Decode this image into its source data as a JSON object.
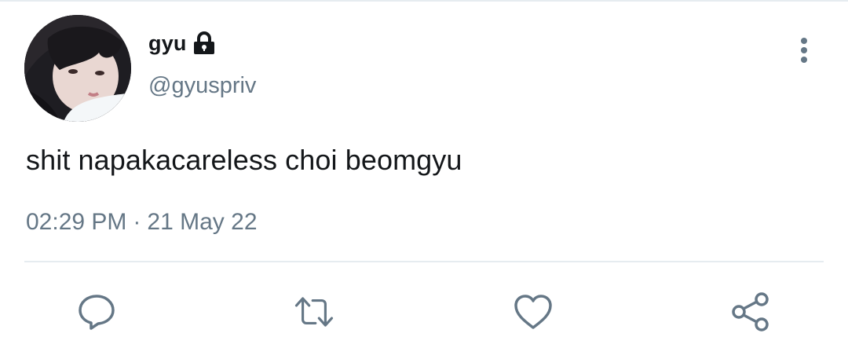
{
  "tweet": {
    "author": {
      "display_name": "gyu",
      "handle": "@gyuspriv",
      "protected_icon": "lock-icon"
    },
    "text": "shit napakacareless choi beomgyu",
    "time": "02:29 PM",
    "separator": "·",
    "date": "21 May 22"
  },
  "actions": [
    {
      "icon": "reply-icon"
    },
    {
      "icon": "retweet-icon"
    },
    {
      "icon": "like-icon"
    },
    {
      "icon": "share-icon"
    }
  ],
  "menu_icon": "more-vertical-icon",
  "colors": {
    "text": "#14171a",
    "secondary": "#657786",
    "divider": "#e6ecf0"
  }
}
